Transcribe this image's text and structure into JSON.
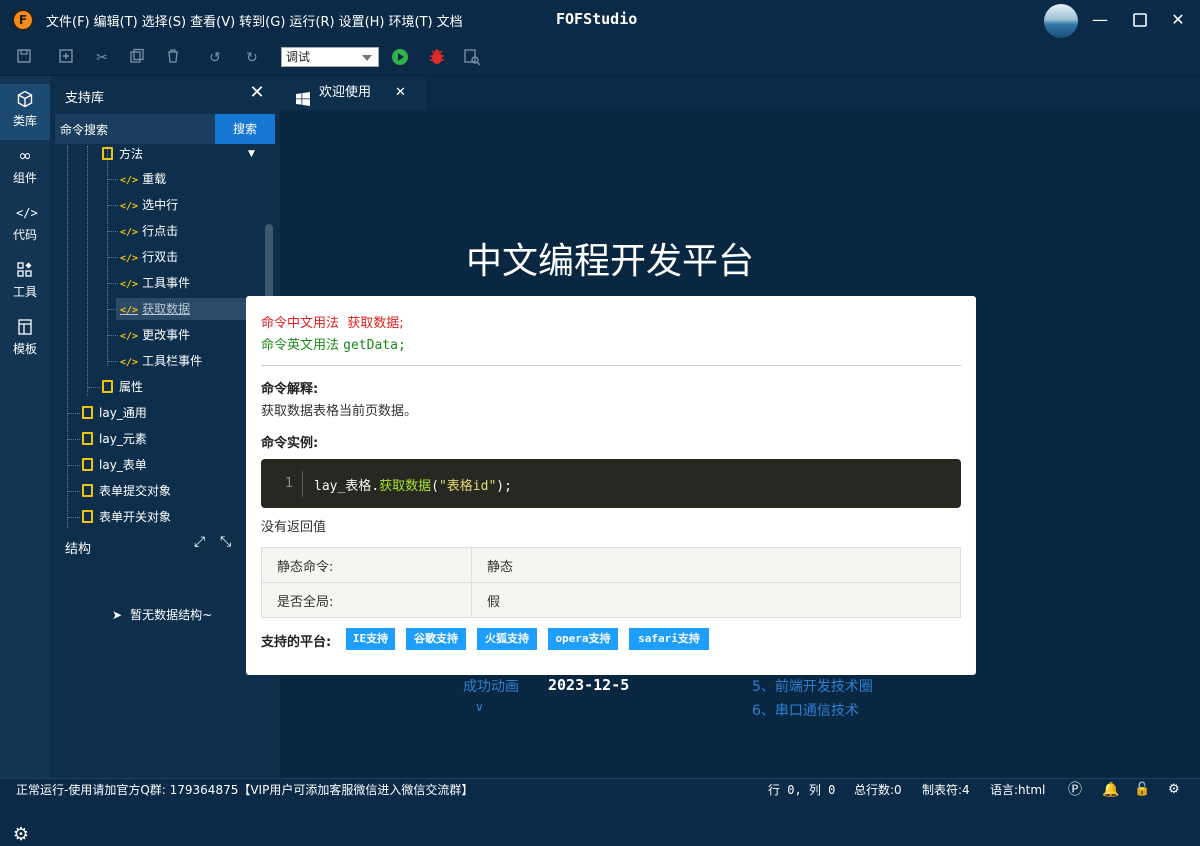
{
  "titlebar": {
    "logo_letter": "F",
    "menu": [
      "文件(F)",
      "编辑(T)",
      "选择(S)",
      "查看(V)",
      "转到(G)",
      "运行(R)",
      "设置(H)",
      "环境(T)",
      "文档"
    ],
    "title": "FOFStudio"
  },
  "toolbar": {
    "run_mode": "调试"
  },
  "activity": {
    "items": [
      {
        "label": "类库",
        "icon": "cube-icon"
      },
      {
        "label": "组件",
        "icon": "infinity-icon"
      },
      {
        "label": "代码",
        "icon": "code-icon"
      },
      {
        "label": "工具",
        "icon": "widgets-icon"
      },
      {
        "label": "模板",
        "icon": "template-icon"
      }
    ]
  },
  "sidepanel": {
    "title": "支持库",
    "search_value": "命令搜索",
    "search_button": "搜索",
    "tree": {
      "group_method": "方法",
      "methods": [
        "重载",
        "选中行",
        "行点击",
        "行双击",
        "工具事件",
        "获取数据",
        "更改事件",
        "工具栏事件"
      ],
      "group_prop": "属性",
      "libs": [
        "lay_通用",
        "lay_元素",
        "lay_表单",
        "表单提交对象",
        "表单开关对象"
      ]
    },
    "struct_title": "结构",
    "no_struct": "暂无数据结构~"
  },
  "editor": {
    "tab": "欢迎使用",
    "welcome_title": "中文编程开发平台",
    "bottom_left_link": "成功动画",
    "bottom_date": "2023-12-5",
    "bottom_links": [
      "5、前端开发技术圈",
      "6、串口通信技术"
    ]
  },
  "popup": {
    "cn_usage_label": "命令中文用法",
    "cn_usage_value": "获取数据;",
    "en_usage_label": "命令英文用法",
    "en_usage_value": "getData;",
    "explain_title": "命令解释:",
    "explain_text": "获取数据表格当前页数据。",
    "example_title": "命令实例:",
    "code_line_no": "1",
    "code_obj": "lay_表格",
    "code_dot": ".",
    "code_method": "获取数据",
    "code_lparen": "(",
    "code_arg": "\"表格id\"",
    "code_rparen": ");",
    "no_return": "没有返回值",
    "table": [
      {
        "label": "静态命令:",
        "value": "静态"
      },
      {
        "label": "是否全局:",
        "value": "假"
      }
    ],
    "platform_label": "支持的平台:",
    "platforms": [
      "IE支持",
      "谷歌支持",
      "火狐支持",
      "opera支持",
      "safari支持"
    ]
  },
  "statusbar": {
    "left": "正常运行-使用请加官方Q群: 179364875【VIP用户可添加客服微信进入微信交流群】",
    "cursor": "行 0, 列 0",
    "total_lines": "总行数:0",
    "tab_chars": "制表符:4",
    "language": "语言:html"
  },
  "colors": {
    "bg": "#0b2a47",
    "accent": "#1677d2",
    "tag": "#1e9fff"
  }
}
